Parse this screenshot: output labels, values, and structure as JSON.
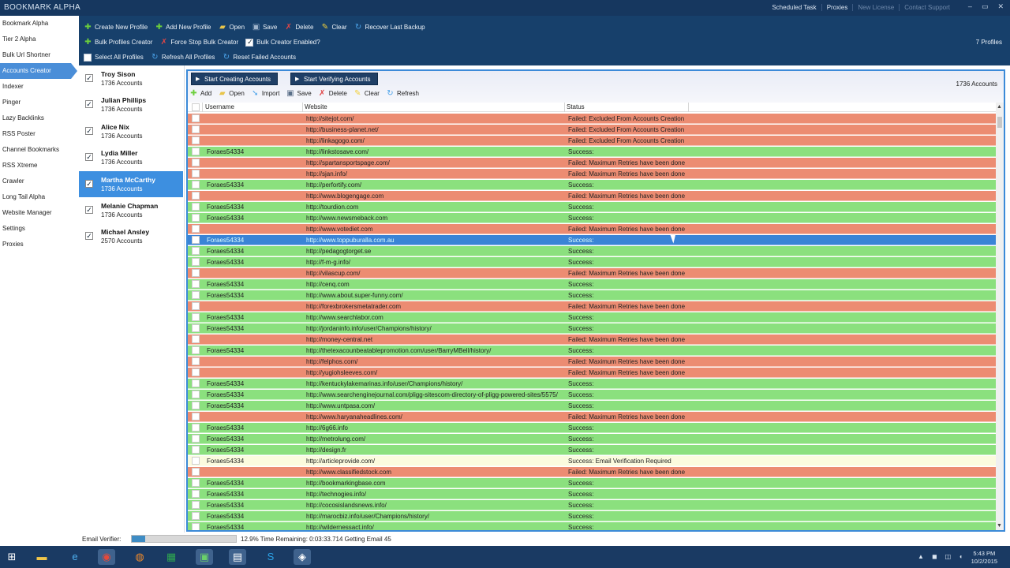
{
  "app": {
    "title": "BOOKMARK ALPHA",
    "top_links": [
      "Scheduled Task",
      "Proxies",
      "New License",
      "Contact Support"
    ],
    "window_buttons": [
      "–",
      "▭",
      "✕"
    ]
  },
  "leftnav": {
    "items": [
      "Bookmark Alpha",
      "Tier 2 Alpha",
      "Bulk Url Shortner",
      "Accounts Creator",
      "Indexer",
      "Pinger",
      "Lazy Backlinks",
      "RSS Poster",
      "Channel Bookmarks",
      "RSS Xtreme",
      "Crawler",
      "Long Tail Alpha",
      "Website Manager",
      "Settings",
      "Proxies"
    ],
    "active_index": 3
  },
  "toolbar": {
    "create_new_profile": "Create New Profile",
    "add_new_profile": "Add New Profile",
    "open": "Open",
    "save": "Save",
    "delete": "Delete",
    "clear": "Clear",
    "recover_last_backup": "Recover Last Backup",
    "bulk_profiles_creator": "Bulk Profiles Creator",
    "force_stop_bulk_creator": "Force Stop Bulk Creator",
    "bulk_creator_enabled": "Bulk Creator Enabled?",
    "select_all_profiles": "Select All Profiles",
    "refresh_all_profiles": "Refresh All Profiles",
    "reset_failed_accounts": "Reset Failed Accounts",
    "profile_count": "7 Profiles"
  },
  "profiles": [
    {
      "name": "Troy  Sison",
      "accounts": "1736 Accounts",
      "checked": true
    },
    {
      "name": "Julian  Phillips",
      "accounts": "1736 Accounts",
      "checked": true
    },
    {
      "name": "Alice  Nix",
      "accounts": "1736 Accounts",
      "checked": true
    },
    {
      "name": "Lydia  Miller",
      "accounts": "1736 Accounts",
      "checked": true
    },
    {
      "name": "Martha  McCarthy",
      "accounts": "1736 Accounts",
      "checked": true
    },
    {
      "name": "Melanie  Chapman",
      "accounts": "1736 Accounts",
      "checked": true
    },
    {
      "name": "Michael  Ansley",
      "accounts": "2570 Accounts",
      "checked": true
    }
  ],
  "main": {
    "start_creating": "Start Creating Accounts",
    "start_verifying": "Start Verifying Accounts",
    "accounts_total": "1736 Accounts",
    "sub_add": "Add",
    "sub_open": "Open",
    "sub_import": "Import",
    "sub_save": "Save",
    "sub_delete": "Delete",
    "sub_clear": "Clear",
    "sub_refresh": "Refresh",
    "columns": [
      "Username",
      "Website",
      "Status"
    ]
  },
  "rows": [
    {
      "user": "",
      "site": "http://sitejot.com/",
      "status": "Failed: Excluded From Accounts Creation",
      "kind": "failed"
    },
    {
      "user": "",
      "site": "http://business-planet.net/",
      "status": "Failed: Excluded From Accounts Creation",
      "kind": "failed"
    },
    {
      "user": "",
      "site": "http://linkagogo.com/",
      "status": "Failed: Excluded From Accounts Creation",
      "kind": "failed"
    },
    {
      "user": "Foraes54334",
      "site": "http://linkstosave.com/",
      "status": "Success:",
      "kind": "success"
    },
    {
      "user": "",
      "site": "http://spartansportspage.com/",
      "status": "Failed: Maximum Retries have been done",
      "kind": "failed"
    },
    {
      "user": "",
      "site": "http://sjan.info/",
      "status": "Failed: Maximum Retries have been done",
      "kind": "failed"
    },
    {
      "user": "Foraes54334",
      "site": "http://perfortify.com/",
      "status": "Success:",
      "kind": "success"
    },
    {
      "user": "",
      "site": "http://www.blogengage.com",
      "status": "Failed: Maximum Retries have been done",
      "kind": "failed"
    },
    {
      "user": "Foraes54334",
      "site": "http://tourdion.com",
      "status": "Success:",
      "kind": "success"
    },
    {
      "user": "Foraes54334",
      "site": "http://www.newsmeback.com",
      "status": "Success:",
      "kind": "success"
    },
    {
      "user": "",
      "site": "http://www.votediet.com",
      "status": "Failed: Maximum Retries have been done",
      "kind": "failed"
    },
    {
      "user": "Foraes54334",
      "site": "http://www.toppuburalla.com.au",
      "status": "Success:",
      "kind": "selected"
    },
    {
      "user": "Foraes54334",
      "site": "http://pedagogtorget.se",
      "status": "Success:",
      "kind": "success"
    },
    {
      "user": "Foraes54334",
      "site": "http://f-m-g.info/",
      "status": "Success:",
      "kind": "success"
    },
    {
      "user": "",
      "site": "http://vilascup.com/",
      "status": "Failed: Maximum Retries have been done",
      "kind": "failed"
    },
    {
      "user": "Foraes54334",
      "site": "http://cenq.com",
      "status": "Success:",
      "kind": "success"
    },
    {
      "user": "Foraes54334",
      "site": "http://www.about.super-funny.com/",
      "status": "Success:",
      "kind": "success"
    },
    {
      "user": "",
      "site": "http://forexbrokersmetatrader.com",
      "status": "Failed: Maximum Retries have been done",
      "kind": "failed"
    },
    {
      "user": "Foraes54334",
      "site": "http://www.searchlabor.com",
      "status": "Success:",
      "kind": "success"
    },
    {
      "user": "Foraes54334",
      "site": "http://jordaninfo.info/user/Champions/history/",
      "status": "Success:",
      "kind": "success"
    },
    {
      "user": "",
      "site": "http://money-central.net",
      "status": "Failed: Maximum Retries have been done",
      "kind": "failed"
    },
    {
      "user": "Foraes54334",
      "site": "http://thetexacounbeatablepromotion.com/user/BarryMBell/history/",
      "status": "Success:",
      "kind": "success"
    },
    {
      "user": "",
      "site": "http://felphos.com/",
      "status": "Failed: Maximum Retries have been done",
      "kind": "failed"
    },
    {
      "user": "",
      "site": "http://yugiohsleeves.com/",
      "status": "Failed: Maximum Retries have been done",
      "kind": "failed"
    },
    {
      "user": "Foraes54334",
      "site": "http://kentuckylakemarinas.info/user/Champions/history/",
      "status": "Success:",
      "kind": "success"
    },
    {
      "user": "Foraes54334",
      "site": "http://www.searchenginejournal.com/pligg-sitescom-directory-of-pligg-powered-sites/5575/",
      "status": "Success:",
      "kind": "success"
    },
    {
      "user": "Foraes54334",
      "site": "http://www.untpasa.com/",
      "status": "Success:",
      "kind": "success"
    },
    {
      "user": "",
      "site": "http://www.haryanaheadlines.com/",
      "status": "Failed: Maximum Retries have been done",
      "kind": "failed"
    },
    {
      "user": "Foraes54334",
      "site": "http://6g66.info",
      "status": "Success:",
      "kind": "success"
    },
    {
      "user": "Foraes54334",
      "site": "http://metrolung.com/",
      "status": "Success:",
      "kind": "success"
    },
    {
      "user": "Foraes54334",
      "site": "http://design.fr",
      "status": "Success:",
      "kind": "success"
    },
    {
      "user": "Foraes54334",
      "site": "http://articleprovide.com/",
      "status": "Success: Email Verification Required",
      "kind": "warn"
    },
    {
      "user": "",
      "site": "http://www.classifiedstock.com",
      "status": "Failed: Maximum Retries have been done",
      "kind": "failed"
    },
    {
      "user": "Foraes54334",
      "site": "http://bookmarkingbase.com",
      "status": "Success:",
      "kind": "success"
    },
    {
      "user": "Foraes54334",
      "site": "http://technogies.info/",
      "status": "Success:",
      "kind": "success"
    },
    {
      "user": "Foraes54334",
      "site": "http://cocosislandsnews.info/",
      "status": "Success:",
      "kind": "success"
    },
    {
      "user": "Foraes54334",
      "site": "http://marocbiz.info/user/Champions/history/",
      "status": "Success:",
      "kind": "success"
    },
    {
      "user": "Foraes54334",
      "site": "http://wildernessact.info/",
      "status": "Success:",
      "kind": "success"
    }
  ],
  "row_colors": {
    "success": "#8be07e",
    "failed": "#ec8c72",
    "warn": "#fbfbde",
    "selected": "#3a84d6"
  },
  "statusbar": {
    "label": "Email Verifier:",
    "progress": 0.129,
    "text": "12.9%  Time Remaining: 0:03:33.714   Getting Email 45"
  },
  "taskbar": {
    "time": "5:43 PM",
    "date": "10/2/2015",
    "icons": [
      "windows-start-icon",
      "file-explorer-icon",
      "internet-explorer-icon",
      "chrome-icon",
      "firefox-icon",
      "excel-icon",
      "app-green-icon",
      "app-notepad-icon",
      "skype-icon",
      "bookmark-alpha-icon"
    ]
  }
}
